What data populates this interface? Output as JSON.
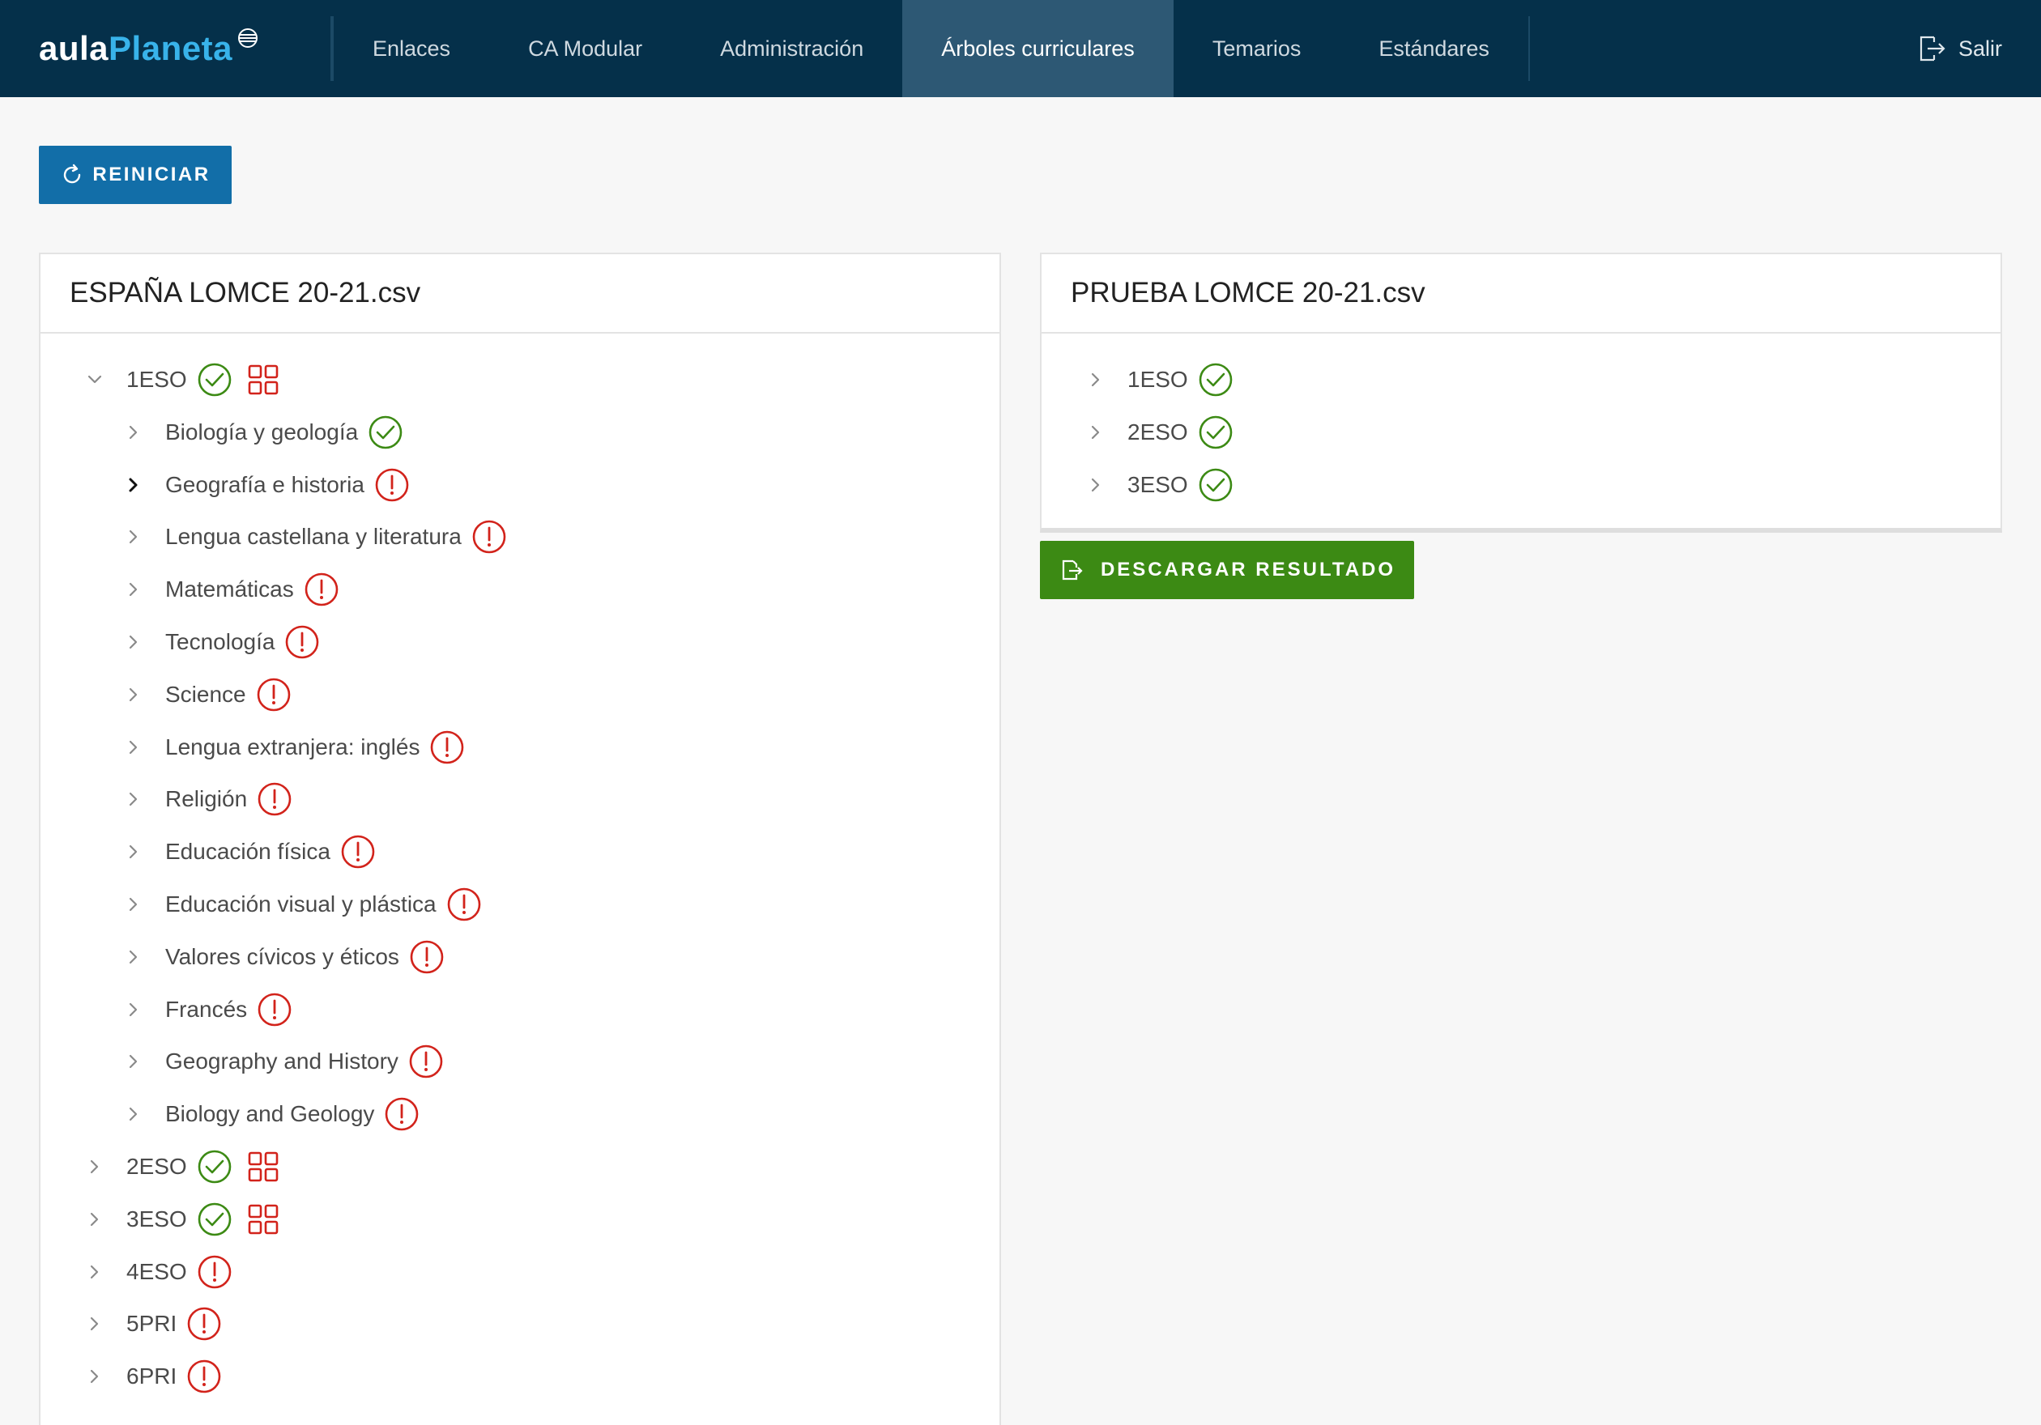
{
  "brand": {
    "part1": "aula",
    "part2": "Planeta"
  },
  "nav": {
    "items": [
      {
        "label": "Enlaces",
        "active": false
      },
      {
        "label": "CA Modular",
        "active": false
      },
      {
        "label": "Administración",
        "active": false
      },
      {
        "label": "Árboles curriculares",
        "active": true
      },
      {
        "label": "Temarios",
        "active": false
      },
      {
        "label": "Estándares",
        "active": false
      }
    ],
    "exit_label": "Salir"
  },
  "actions": {
    "reset_label": "REINICIAR",
    "download_label": "DESCARGAR RESULTADO"
  },
  "colors": {
    "topbar": "#05304a",
    "nav_active": "#2d5874",
    "reset_button": "#126ea8",
    "download_button": "#3c8a14",
    "ok": "#3c8a14",
    "error": "#d2231b"
  },
  "left_panel": {
    "title": "ESPAÑA LOMCE 20-21.csv",
    "tree": [
      {
        "label": "1ESO",
        "level": 0,
        "expanded": true,
        "status": "ok",
        "grid": true
      },
      {
        "label": "Biología y geología",
        "level": 1,
        "expanded": false,
        "status": "ok",
        "grid": false
      },
      {
        "label": "Geografía e historia",
        "level": 1,
        "expanded": false,
        "status": "error",
        "grid": false,
        "hover": true
      },
      {
        "label": "Lengua castellana y literatura",
        "level": 1,
        "expanded": false,
        "status": "error",
        "grid": false
      },
      {
        "label": "Matemáticas",
        "level": 1,
        "expanded": false,
        "status": "error",
        "grid": false
      },
      {
        "label": "Tecnología",
        "level": 1,
        "expanded": false,
        "status": "error",
        "grid": false
      },
      {
        "label": "Science",
        "level": 1,
        "expanded": false,
        "status": "error",
        "grid": false
      },
      {
        "label": "Lengua extranjera: inglés",
        "level": 1,
        "expanded": false,
        "status": "error",
        "grid": false
      },
      {
        "label": "Religión",
        "level": 1,
        "expanded": false,
        "status": "error",
        "grid": false
      },
      {
        "label": "Educación física",
        "level": 1,
        "expanded": false,
        "status": "error",
        "grid": false
      },
      {
        "label": "Educación visual y plástica",
        "level": 1,
        "expanded": false,
        "status": "error",
        "grid": false
      },
      {
        "label": "Valores cívicos y éticos",
        "level": 1,
        "expanded": false,
        "status": "error",
        "grid": false
      },
      {
        "label": "Francés",
        "level": 1,
        "expanded": false,
        "status": "error",
        "grid": false
      },
      {
        "label": "Geography and History",
        "level": 1,
        "expanded": false,
        "status": "error",
        "grid": false
      },
      {
        "label": "Biology and Geology",
        "level": 1,
        "expanded": false,
        "status": "error",
        "grid": false
      },
      {
        "label": "2ESO",
        "level": 0,
        "expanded": false,
        "status": "ok",
        "grid": true
      },
      {
        "label": "3ESO",
        "level": 0,
        "expanded": false,
        "status": "ok",
        "grid": true
      },
      {
        "label": "4ESO",
        "level": 0,
        "expanded": false,
        "status": "error",
        "grid": false
      },
      {
        "label": "5PRI",
        "level": 0,
        "expanded": false,
        "status": "error",
        "grid": false
      },
      {
        "label": "6PRI",
        "level": 0,
        "expanded": false,
        "status": "error",
        "grid": false
      }
    ]
  },
  "right_panel": {
    "title": "PRUEBA LOMCE 20-21.csv",
    "tree": [
      {
        "label": "1ESO",
        "level": 0,
        "expanded": false,
        "status": "ok",
        "grid": false
      },
      {
        "label": "2ESO",
        "level": 0,
        "expanded": false,
        "status": "ok",
        "grid": false
      },
      {
        "label": "3ESO",
        "level": 0,
        "expanded": false,
        "status": "ok",
        "grid": false
      }
    ]
  }
}
